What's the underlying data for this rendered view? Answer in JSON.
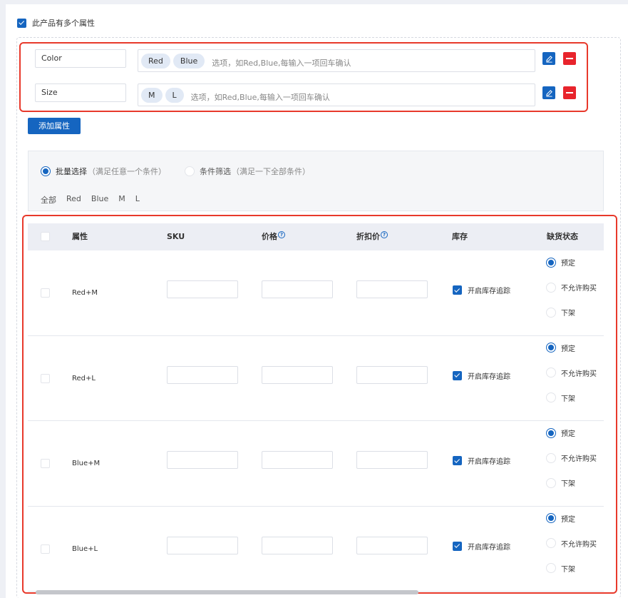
{
  "variant_toggle": {
    "label": "此产品有多个属性",
    "checked": true
  },
  "attributes": [
    {
      "name": "Color",
      "values": [
        "Red",
        "Blue"
      ],
      "placeholder": "选项，如Red,Blue,每输入一项回车确认"
    },
    {
      "name": "Size",
      "values": [
        "M",
        "L"
      ],
      "placeholder": "选项，如Red,Blue,每输入一项回车确认"
    }
  ],
  "add_attribute_label": "添加属性",
  "filter": {
    "modes": [
      {
        "label": "批量选择",
        "hint": "（满足任意一个条件）",
        "selected": true
      },
      {
        "label": "条件筛选",
        "hint": "（满足一下全部条件）",
        "selected": false
      }
    ],
    "options": [
      "全部",
      "Red",
      "Blue",
      "M",
      "L"
    ]
  },
  "table": {
    "headers": {
      "attr": "属性",
      "sku": "SKU",
      "price": "价格",
      "discount": "折扣价",
      "stock": "库存",
      "status": "缺货状态"
    },
    "help_glyph": "?",
    "stock_label": "开启库存追踪",
    "status_options": [
      "预定",
      "不允许购买",
      "下架"
    ],
    "rows": [
      {
        "attr": "Red+M",
        "stock_tracking": true,
        "status_selected": 0
      },
      {
        "attr": "Red+L",
        "stock_tracking": true,
        "status_selected": 0
      },
      {
        "attr": "Blue+M",
        "stock_tracking": true,
        "status_selected": 0
      },
      {
        "attr": "Blue+L",
        "stock_tracking": true,
        "status_selected": 0
      }
    ]
  },
  "colors": {
    "accent": "#1565c0",
    "danger": "#e8242c",
    "highlight_frame": "#e8392b"
  }
}
